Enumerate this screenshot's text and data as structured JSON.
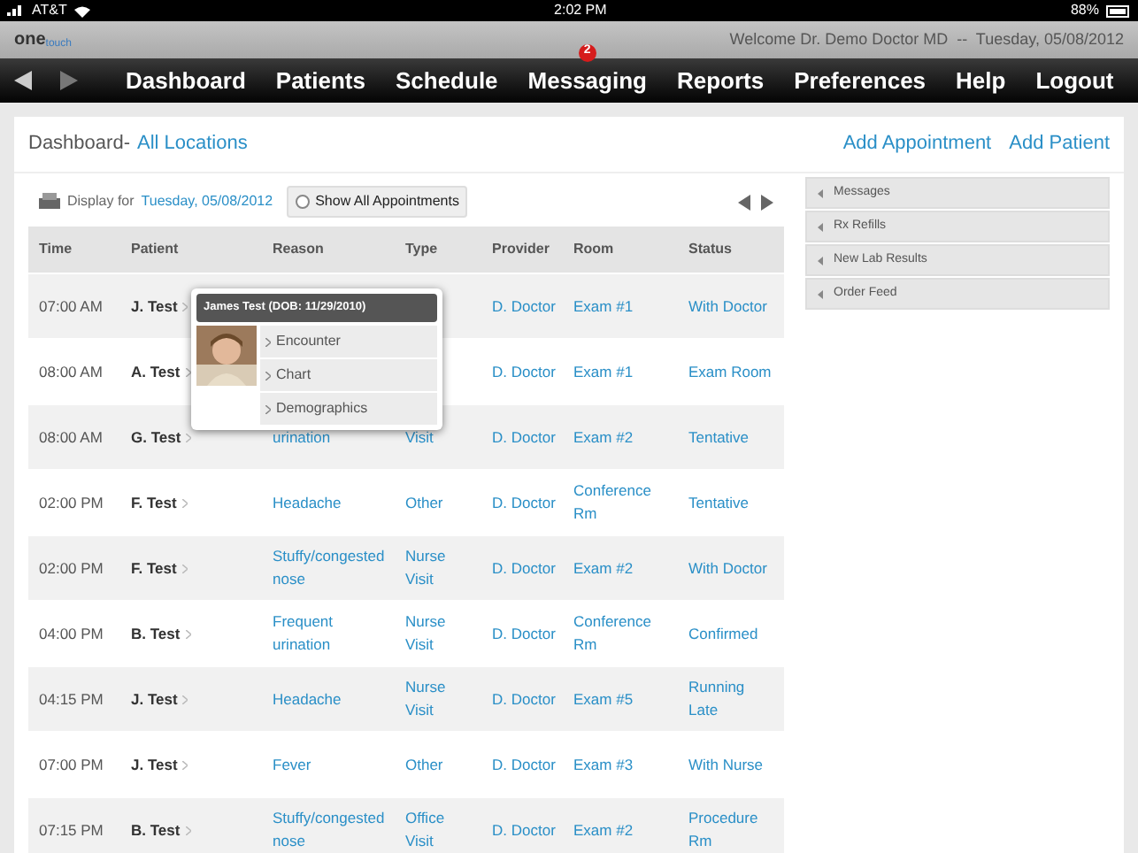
{
  "status_bar": {
    "carrier": "AT&T",
    "time": "2:02 PM",
    "battery": "88%"
  },
  "header": {
    "logo": {
      "word": "one",
      "sub": "touch"
    },
    "welcome": "Welcome Dr. Demo Doctor MD  --  Tuesday, 05/08/2012"
  },
  "nav": {
    "items": [
      {
        "label": "Dashboard"
      },
      {
        "label": "Patients"
      },
      {
        "label": "Schedule"
      },
      {
        "label": "Messaging",
        "badge": "2"
      },
      {
        "label": "Reports"
      },
      {
        "label": "Preferences"
      },
      {
        "label": "Help"
      },
      {
        "label": "Logout"
      }
    ]
  },
  "page": {
    "title": "Dashboard-",
    "location": "All Locations",
    "actions": [
      "Add Appointment",
      "Add Patient"
    ]
  },
  "toolbar": {
    "display_for": "Display for",
    "date": "Tuesday, 05/08/2012",
    "show_all": {
      "label": "Show All Appointments",
      "checked": false
    }
  },
  "table": {
    "columns": [
      "Time",
      "Patient",
      "Reason",
      "Type",
      "Provider",
      "Room",
      "Status"
    ],
    "rows": [
      {
        "time": "07:00 AM",
        "patient": "J. Test",
        "provider": "D. Doctor",
        "room": "Exam #1",
        "status": "With Doctor"
      },
      {
        "time": "08:00 AM",
        "patient": "A. Test",
        "provider": "D. Doctor",
        "room": "Exam #1",
        "status": "Exam Room"
      },
      {
        "time": "08:00 AM",
        "patient": "G. Test",
        "reason": "urination",
        "type": "Visit",
        "provider": "D. Doctor",
        "room": "Exam #2",
        "status": "Tentative"
      },
      {
        "time": "02:00 PM",
        "patient": "F. Test",
        "reason": "Headache",
        "type": "Other",
        "provider": "D. Doctor",
        "room": "Conference Rm",
        "status": "Tentative"
      },
      {
        "time": "02:00 PM",
        "patient": "F. Test",
        "reason": "Stuffy/congested nose",
        "type": "Nurse Visit",
        "provider": "D. Doctor",
        "room": "Exam #2",
        "status": "With Doctor"
      },
      {
        "time": "04:00 PM",
        "patient": "B. Test",
        "reason": "Frequent urination",
        "type": "Nurse Visit",
        "provider": "D. Doctor",
        "room": "Conference Rm",
        "status": "Confirmed"
      },
      {
        "time": "04:15 PM",
        "patient": "J. Test",
        "reason": "Headache",
        "type": "Nurse Visit",
        "provider": "D. Doctor",
        "room": "Exam #5",
        "status": "Running Late"
      },
      {
        "time": "07:00 PM",
        "patient": "J. Test",
        "reason": "Fever",
        "type": "Other",
        "provider": "D. Doctor",
        "room": "Exam #3",
        "status": "With Nurse"
      },
      {
        "time": "07:15 PM",
        "patient": "B. Test",
        "reason": "Stuffy/congested nose",
        "type": "Office Visit",
        "provider": "D. Doctor",
        "room": "Exam #2",
        "status": "Procedure Rm"
      }
    ]
  },
  "popup": {
    "title": "James Test (DOB: 11/29/2010)",
    "photo": {
      "kind": "picture"
    },
    "items": [
      "Encounter",
      "Chart",
      "Demographics"
    ]
  },
  "sidebar": {
    "items": [
      "Messages",
      "Rx Refills",
      "New Lab Results",
      "Order Feed"
    ]
  }
}
